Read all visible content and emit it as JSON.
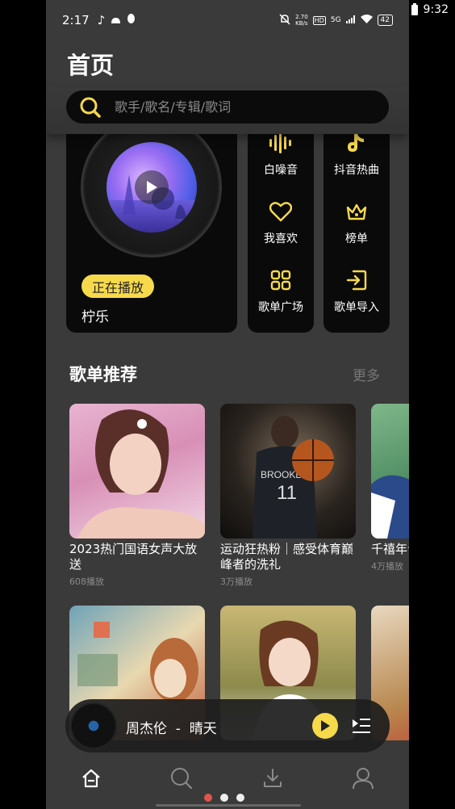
{
  "outer_status": {
    "time": "9:32"
  },
  "status_bar": {
    "time": "2:17",
    "speed_value": "2.70",
    "speed_unit": "KB/s",
    "hd": "HD",
    "network": "5G",
    "battery": "42"
  },
  "header": {
    "title": "首页"
  },
  "search": {
    "placeholder": "歌手/歌名/专辑/歌词"
  },
  "player_card": {
    "badge": "正在播放",
    "song": "柠乐"
  },
  "grid": [
    {
      "label": "白噪音",
      "icon": "waveform-icon"
    },
    {
      "label": "抖音热曲",
      "icon": "tiktok-icon"
    },
    {
      "label": "我喜欢",
      "icon": "heart-icon"
    },
    {
      "label": "榜单",
      "icon": "crown-icon"
    },
    {
      "label": "歌单广场",
      "icon": "grid-icon"
    },
    {
      "label": "歌单导入",
      "icon": "import-icon"
    }
  ],
  "playlist_section": {
    "title": "歌单推荐",
    "more": "更多",
    "items": [
      {
        "title": "2023热门国语女声大放送",
        "plays": "608播放"
      },
      {
        "title": "运动狂热粉｜感受体育巅峰者的洗礼",
        "plays": "3万播放"
      },
      {
        "title": "千禧年青春时",
        "plays": "4万播放"
      }
    ]
  },
  "mini_player": {
    "song": "周杰伦  -  晴天"
  },
  "colors": {
    "accent": "#f7d94c",
    "background": "#3a3a3a",
    "card": "#0a0a0a"
  }
}
